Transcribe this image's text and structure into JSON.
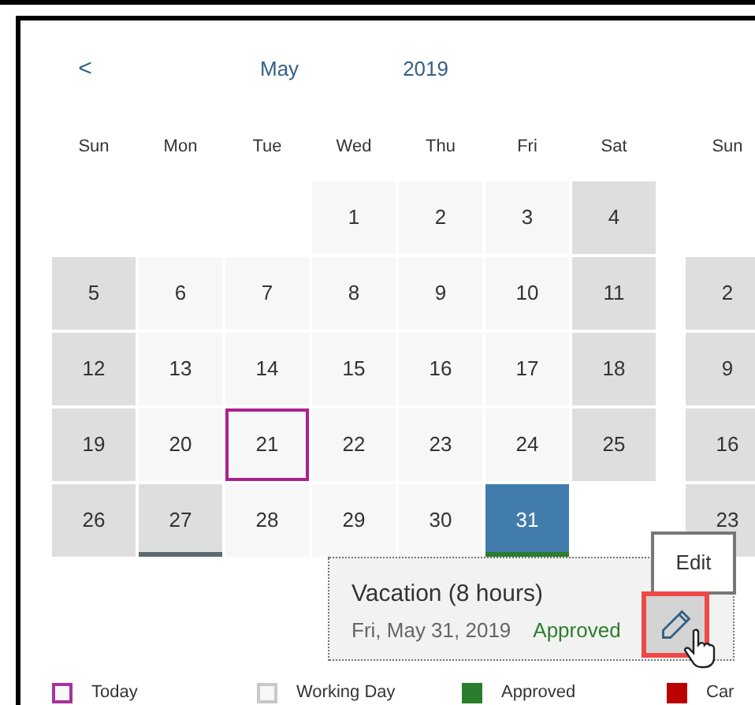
{
  "header": {
    "prev": "<",
    "month": "May",
    "year": "2019"
  },
  "weekdays": [
    "Sun",
    "Mon",
    "Tue",
    "Wed",
    "Thu",
    "Fri",
    "Sat"
  ],
  "next_weekday": "Sun",
  "weeks": [
    [
      {
        "kind": "empty"
      },
      {
        "kind": "empty"
      },
      {
        "kind": "empty"
      },
      {
        "day": "1",
        "kind": "working",
        "today": false,
        "selected": false
      },
      {
        "day": "2",
        "kind": "working",
        "today": false,
        "selected": false
      },
      {
        "day": "3",
        "kind": "working",
        "today": false,
        "selected": false
      },
      {
        "day": "4",
        "kind": "weekend",
        "today": false,
        "selected": false
      }
    ],
    [
      {
        "day": "5",
        "kind": "weekend",
        "today": false,
        "selected": false
      },
      {
        "day": "6",
        "kind": "working",
        "today": false,
        "selected": false
      },
      {
        "day": "7",
        "kind": "working",
        "today": false,
        "selected": false
      },
      {
        "day": "8",
        "kind": "working",
        "today": false,
        "selected": false
      },
      {
        "day": "9",
        "kind": "working",
        "today": false,
        "selected": false
      },
      {
        "day": "10",
        "kind": "working",
        "today": false,
        "selected": false
      },
      {
        "day": "11",
        "kind": "weekend",
        "today": false,
        "selected": false
      }
    ],
    [
      {
        "day": "12",
        "kind": "weekend",
        "today": false,
        "selected": false
      },
      {
        "day": "13",
        "kind": "working",
        "today": false,
        "selected": false
      },
      {
        "day": "14",
        "kind": "working",
        "today": false,
        "selected": false
      },
      {
        "day": "15",
        "kind": "working",
        "today": false,
        "selected": false
      },
      {
        "day": "16",
        "kind": "working",
        "today": false,
        "selected": false
      },
      {
        "day": "17",
        "kind": "working",
        "today": false,
        "selected": false
      },
      {
        "day": "18",
        "kind": "weekend",
        "today": false,
        "selected": false
      }
    ],
    [
      {
        "day": "19",
        "kind": "weekend",
        "today": false,
        "selected": false
      },
      {
        "day": "20",
        "kind": "working",
        "today": false,
        "selected": false
      },
      {
        "day": "21",
        "kind": "working",
        "today": true,
        "selected": false
      },
      {
        "day": "22",
        "kind": "working",
        "today": false,
        "selected": false
      },
      {
        "day": "23",
        "kind": "working",
        "today": false,
        "selected": false
      },
      {
        "day": "24",
        "kind": "working",
        "today": false,
        "selected": false
      },
      {
        "day": "25",
        "kind": "weekend",
        "today": false,
        "selected": false
      }
    ],
    [
      {
        "day": "26",
        "kind": "weekend",
        "today": false,
        "selected": false
      },
      {
        "day": "27",
        "kind": "weekend",
        "today": false,
        "selected": false,
        "color": "#5b6a70"
      },
      {
        "day": "28",
        "kind": "working",
        "today": false,
        "selected": false
      },
      {
        "day": "29",
        "kind": "working",
        "today": false,
        "selected": false
      },
      {
        "day": "30",
        "kind": "working",
        "today": false,
        "selected": false
      },
      {
        "day": "31",
        "kind": "working",
        "today": false,
        "selected": true,
        "color": "#2b7d2b"
      },
      {
        "kind": "empty"
      }
    ]
  ],
  "next_month_sundays": [
    {
      "kind": "empty"
    },
    {
      "day": "2",
      "kind": "weekend",
      "today": false,
      "selected": false
    },
    {
      "day": "9",
      "kind": "weekend",
      "today": false,
      "selected": false
    },
    {
      "day": "16",
      "kind": "weekend",
      "today": false,
      "selected": false
    },
    {
      "day": "23",
      "kind": "weekend",
      "today": false,
      "selected": false
    }
  ],
  "popover": {
    "title": "Vacation (8 hours)",
    "date": "Fri, May 31, 2019",
    "status": "Approved",
    "tooltip": "Edit"
  },
  "legend": [
    {
      "label": "Today",
      "kind": "outline",
      "color": "#a8329a"
    },
    {
      "label": "Working Day",
      "kind": "outline",
      "color": "#c8c8c8"
    },
    {
      "label": "Approved",
      "kind": "filled",
      "color": "#2b7d2b"
    },
    {
      "label": "Car",
      "kind": "filled",
      "color": "#bb0000"
    }
  ]
}
